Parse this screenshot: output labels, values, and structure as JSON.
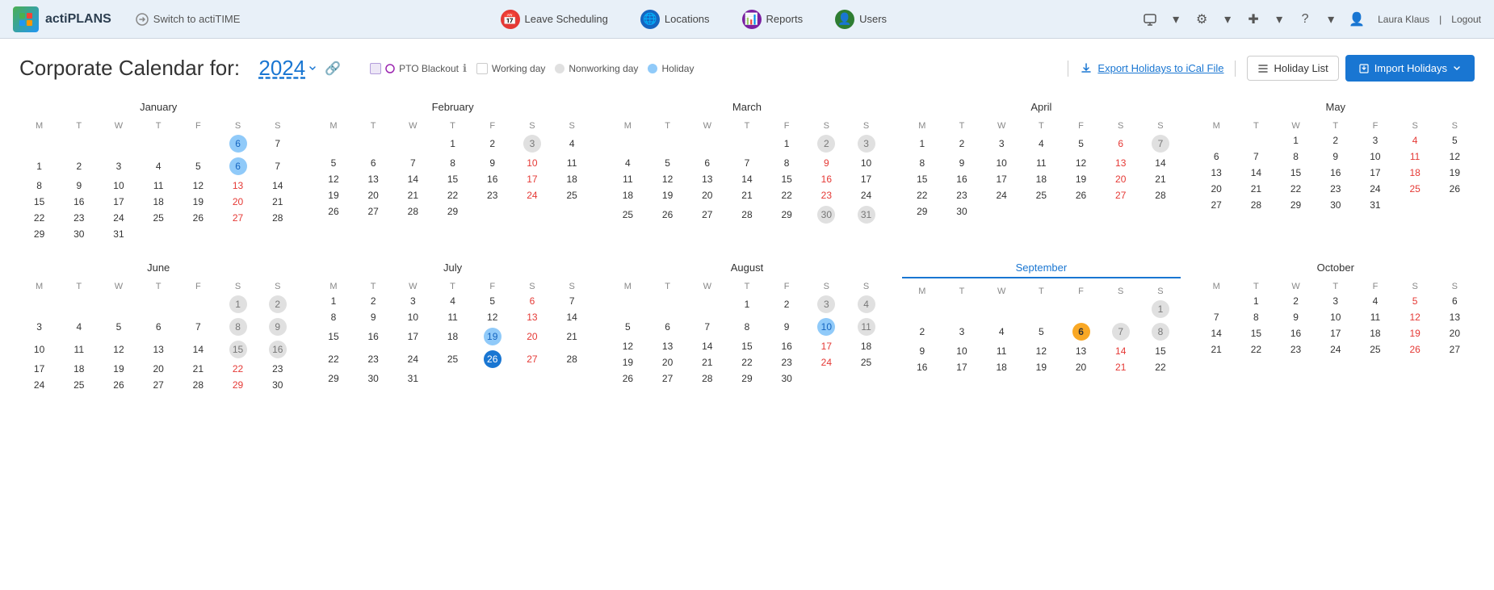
{
  "app": {
    "logo_text": "actiPLANS",
    "logo_abbr": "AP",
    "switch_label": "Switch to actiTIME"
  },
  "nav": {
    "items": [
      {
        "id": "leave-scheduling",
        "label": "Leave Scheduling",
        "icon_color": "red",
        "icon": "📅"
      },
      {
        "id": "locations",
        "label": "Locations",
        "icon_color": "blue",
        "icon": "🌐"
      },
      {
        "id": "reports",
        "label": "Reports",
        "icon_color": "purple",
        "icon": "📊"
      },
      {
        "id": "users",
        "label": "Users",
        "icon_color": "green",
        "icon": "👤"
      }
    ],
    "user": "Laura Klaus",
    "logout": "Logout"
  },
  "page": {
    "title_prefix": "Corporate Calendar for:",
    "year": "2024",
    "link_icon": "🔗"
  },
  "legend": {
    "pto_blackout": "PTO Blackout",
    "working_day": "Working day",
    "nonworking_day": "Nonworking day",
    "holiday": "Holiday"
  },
  "actions": {
    "export_label": "Export Holidays to iCal File",
    "holiday_list_label": "Holiday List",
    "import_label": "Import Holidays"
  },
  "months": [
    {
      "name": "January",
      "highlight": false,
      "weeks": [
        [
          null,
          null,
          null,
          null,
          null,
          "6h",
          "7w"
        ],
        [
          "1",
          "2",
          "3",
          "4",
          "5",
          "6h",
          "7w"
        ],
        [
          "8",
          "9",
          "10",
          "11",
          "12",
          "13w",
          "14w"
        ],
        [
          "15",
          "16",
          "17",
          "18",
          "19",
          "20w",
          "21w"
        ],
        [
          "22",
          "23",
          "24",
          "25",
          "26",
          "27w",
          "28w"
        ],
        [
          "29",
          "30",
          "31",
          null,
          null,
          null,
          null
        ]
      ],
      "special": {
        "6": "nonworking",
        "7": "weekend",
        "13": "weekend-red",
        "14": "weekend",
        "20": "weekend-red",
        "21": "weekend",
        "27": "weekend-red",
        "28": "weekend"
      }
    },
    {
      "name": "February",
      "highlight": false,
      "weeks": [
        [
          null,
          null,
          null,
          "1",
          "2",
          "3w",
          "4w"
        ],
        [
          "5",
          "6",
          "7",
          "8",
          "9",
          "10w",
          "11w"
        ],
        [
          "12",
          "13",
          "14",
          "15",
          "16",
          "17w",
          "18w"
        ],
        [
          "19",
          "20",
          "21",
          "22",
          "23",
          "24w",
          "25w"
        ],
        [
          "26",
          "27",
          "28",
          "29",
          null,
          null,
          null
        ]
      ],
      "special": {
        "3": "nonworking-weekend",
        "4": "weekend",
        "10": "weekend-red",
        "11": "weekend",
        "17": "weekend-red",
        "18": "weekend",
        "24": "weekend-red",
        "25": "weekend"
      }
    },
    {
      "name": "March",
      "highlight": false,
      "weeks": [
        [
          null,
          null,
          null,
          null,
          "1",
          "2n",
          "3n"
        ],
        [
          "4",
          "5",
          "6",
          "7",
          "8",
          "9w",
          "10w"
        ],
        [
          "11",
          "12",
          "13",
          "14",
          "15",
          "16w",
          "17w"
        ],
        [
          "18",
          "19",
          "20",
          "21",
          "22",
          "23w",
          "24w"
        ],
        [
          "25",
          "26",
          "27",
          "28",
          "29",
          "30n",
          "31n"
        ]
      ],
      "special": {
        "2": "nonworking",
        "3": "nonworking",
        "9": "weekend-red",
        "10": "weekend",
        "16": "weekend-red",
        "17": "weekend",
        "23": "weekend-red",
        "24": "weekend",
        "30": "nonworking",
        "31": "nonworking"
      }
    },
    {
      "name": "April",
      "highlight": false,
      "weeks": [
        [
          "1",
          "2",
          "3",
          "4",
          "5",
          "6w",
          "7w"
        ],
        [
          "8",
          "9",
          "10",
          "11",
          "12",
          "13w",
          "14w"
        ],
        [
          "15",
          "16",
          "17",
          "18",
          "19",
          "20w",
          "21w"
        ],
        [
          "22",
          "23",
          "24",
          "25",
          "26",
          "27w",
          "28w"
        ],
        [
          "29",
          "30",
          null,
          null,
          null,
          null,
          null
        ]
      ],
      "special": {
        "6": "weekend-red",
        "7": "nonworking",
        "13": "weekend-red",
        "14": "weekend",
        "20": "weekend-red",
        "21": "weekend",
        "27": "weekend-red",
        "28": "weekend"
      }
    },
    {
      "name": "May",
      "highlight": false,
      "weeks": [
        [
          null,
          null,
          "1",
          "2",
          "3",
          "4w",
          "5w"
        ],
        [
          "6",
          "7",
          "8",
          "9",
          "10",
          "11w",
          "12w"
        ],
        [
          "13",
          "14",
          "15",
          "16",
          "17",
          "18w",
          "19w"
        ],
        [
          "20",
          "21",
          "22",
          "23",
          "24",
          "25w",
          "26w"
        ],
        [
          "27",
          "28",
          "29",
          "30",
          "31",
          null,
          null
        ]
      ],
      "special": {
        "4": "weekend-red",
        "5": "weekend",
        "11": "weekend-red",
        "12": "weekend",
        "18": "weekend-red",
        "19": "weekend",
        "25": "weekend-red",
        "26": "weekend"
      }
    },
    {
      "name": "June",
      "highlight": false,
      "weeks": [
        [
          null,
          null,
          null,
          null,
          null,
          "1n",
          "2n"
        ],
        [
          "3",
          "4",
          "5",
          "6",
          "7",
          "8n",
          "9n"
        ],
        [
          "10",
          "11",
          "12",
          "13",
          "14",
          "15n",
          "16n"
        ],
        [
          "17",
          "18",
          "19",
          "20",
          "21",
          "22w",
          "23w"
        ],
        [
          "24",
          "25",
          "26",
          "27",
          "28",
          "29w",
          "30w"
        ]
      ],
      "special": {
        "1": "nonworking",
        "2": "nonworking",
        "8": "nonworking",
        "9": "nonworking",
        "15": "nonworking",
        "16": "nonworking",
        "22": "weekend-red",
        "23": "weekend",
        "29": "weekend-red",
        "30": "weekend"
      }
    },
    {
      "name": "July",
      "highlight": false,
      "weeks": [
        [
          "1",
          "2",
          "3",
          "4",
          "5",
          "6w",
          "7w"
        ],
        [
          "8",
          "9",
          "10",
          "11",
          "12",
          "13w",
          "14w"
        ],
        [
          "15",
          "16",
          "17",
          "18",
          "19h",
          "20w",
          "21w"
        ],
        [
          "22",
          "23",
          "24",
          "25",
          "26b",
          "27w",
          "28w"
        ],
        [
          "29",
          "30",
          "31",
          null,
          null,
          null,
          null
        ]
      ],
      "special": {
        "6": "weekend-red",
        "7": "weekend",
        "13": "weekend-red",
        "14": "weekend",
        "19": "holiday",
        "20": "weekend-red",
        "21": "weekend",
        "26": "selected-blue",
        "27": "weekend-red",
        "28": "weekend"
      }
    },
    {
      "name": "August",
      "highlight": false,
      "weeks": [
        [
          null,
          null,
          null,
          "1",
          "2",
          "3n",
          "4n"
        ],
        [
          "5",
          "6",
          "7",
          "8",
          "9",
          "10h",
          "11n"
        ],
        [
          "12",
          "13",
          "14",
          "15",
          "16",
          "17w",
          "18w"
        ],
        [
          "19",
          "20",
          "21",
          "22",
          "23",
          "24w",
          "25w"
        ],
        [
          "26",
          "27",
          "28",
          "29",
          "30",
          null,
          null
        ]
      ],
      "special": {
        "3": "nonworking",
        "4": "nonworking",
        "10": "holiday",
        "11": "nonworking",
        "17": "weekend-red",
        "18": "weekend",
        "24": "weekend-red",
        "25": "weekend"
      }
    },
    {
      "name": "September",
      "highlight": true,
      "weeks": [
        [
          null,
          null,
          null,
          null,
          null,
          null,
          "1n"
        ],
        [
          "2",
          "3",
          "4",
          "5",
          "6t",
          "7n",
          "8n"
        ],
        [
          "9",
          "10",
          "11",
          "12",
          "13",
          "14w",
          "15w"
        ],
        [
          "16",
          "17",
          "18",
          "19",
          "20",
          "21w",
          "22w"
        ],
        [
          null,
          null,
          null,
          null,
          null,
          null,
          null
        ]
      ],
      "special": {
        "1": "nonworking",
        "6": "today",
        "7": "nonworking",
        "8": "nonworking",
        "14": "weekend-red",
        "15": "weekend",
        "21": "weekend-red",
        "22": "weekend"
      }
    },
    {
      "name": "October",
      "highlight": false,
      "weeks": [
        [
          null,
          "1",
          "2",
          "3",
          "4",
          "5w",
          "6w"
        ],
        [
          "7",
          "8",
          "9",
          "10",
          "11",
          "12w",
          "13w"
        ],
        [
          "14",
          "15",
          "16",
          "17",
          "18",
          "19w",
          "20w"
        ],
        [
          "21",
          "22",
          "23",
          "24",
          "25",
          "26w",
          "27w"
        ],
        [
          null,
          null,
          null,
          null,
          null,
          null,
          null
        ]
      ],
      "special": {
        "5": "weekend-red",
        "6": "weekend",
        "12": "weekend-red",
        "13": "weekend",
        "19": "weekend-red",
        "20": "weekend",
        "26": "weekend-red",
        "27": "weekend"
      }
    }
  ]
}
